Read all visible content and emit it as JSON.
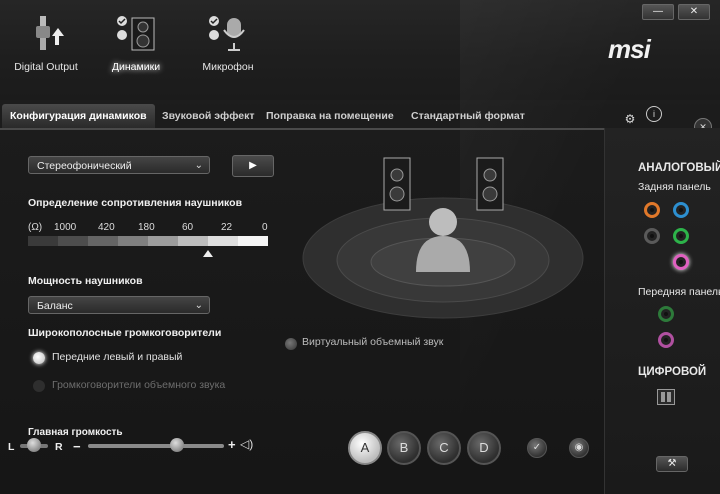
{
  "window": {
    "minimize_label": "—",
    "close_label": "✕"
  },
  "brand": "msi",
  "devices": [
    {
      "label": "Digital Output"
    },
    {
      "label": "Динамики"
    },
    {
      "label": "Микрофон"
    }
  ],
  "tabs": [
    "Конфигурация динамиков",
    "Звуковой эффект",
    "Поправка на помещение",
    "Стандартный формат"
  ],
  "config": {
    "mode_value": "Стереофонический",
    "play_label": "▶",
    "impedance_heading": "Определение сопротивления наушников",
    "impedance_unit": "(Ω)",
    "impedance_values": [
      "1000",
      "420",
      "180",
      "60",
      "22",
      "0"
    ],
    "power_heading": "Мощность наушников",
    "power_value": "Баланс",
    "fullrange_heading": "Широкополосные громкоговорители",
    "fullrange_options": [
      "Передние левый и правый",
      "Громкоговорители объемного звука"
    ],
    "virtual_surround_label": "Виртуальный объемный звук"
  },
  "volume": {
    "heading": "Главная громкость",
    "left": "L",
    "right": "R",
    "minus": "−",
    "plus": "+"
  },
  "presets": [
    "A",
    "B",
    "C",
    "D"
  ],
  "right_panel": {
    "analog_heading": "АНАЛОГОВЫЙ",
    "rear_label": "Задняя панель",
    "front_label": "Передняя панель",
    "digital_heading": "ЦИФРОВОЙ"
  },
  "colors": {
    "jack_orange": "#e0782a",
    "jack_blue": "#2d8fd0",
    "jack_black": "#5a5a5a",
    "jack_green": "#2db34a",
    "jack_pink": "#e060c0",
    "jack_front_green": "#2d7a3a",
    "jack_front_pink": "#b050a0"
  },
  "icons": [
    "digital-output-icon",
    "speaker-icon",
    "microphone-icon",
    "settings-icon",
    "info-icon",
    "tools-icon",
    "check-icon",
    "mic-icon",
    "volume-icon",
    "wrench-icon",
    "digital-port-icon"
  ]
}
